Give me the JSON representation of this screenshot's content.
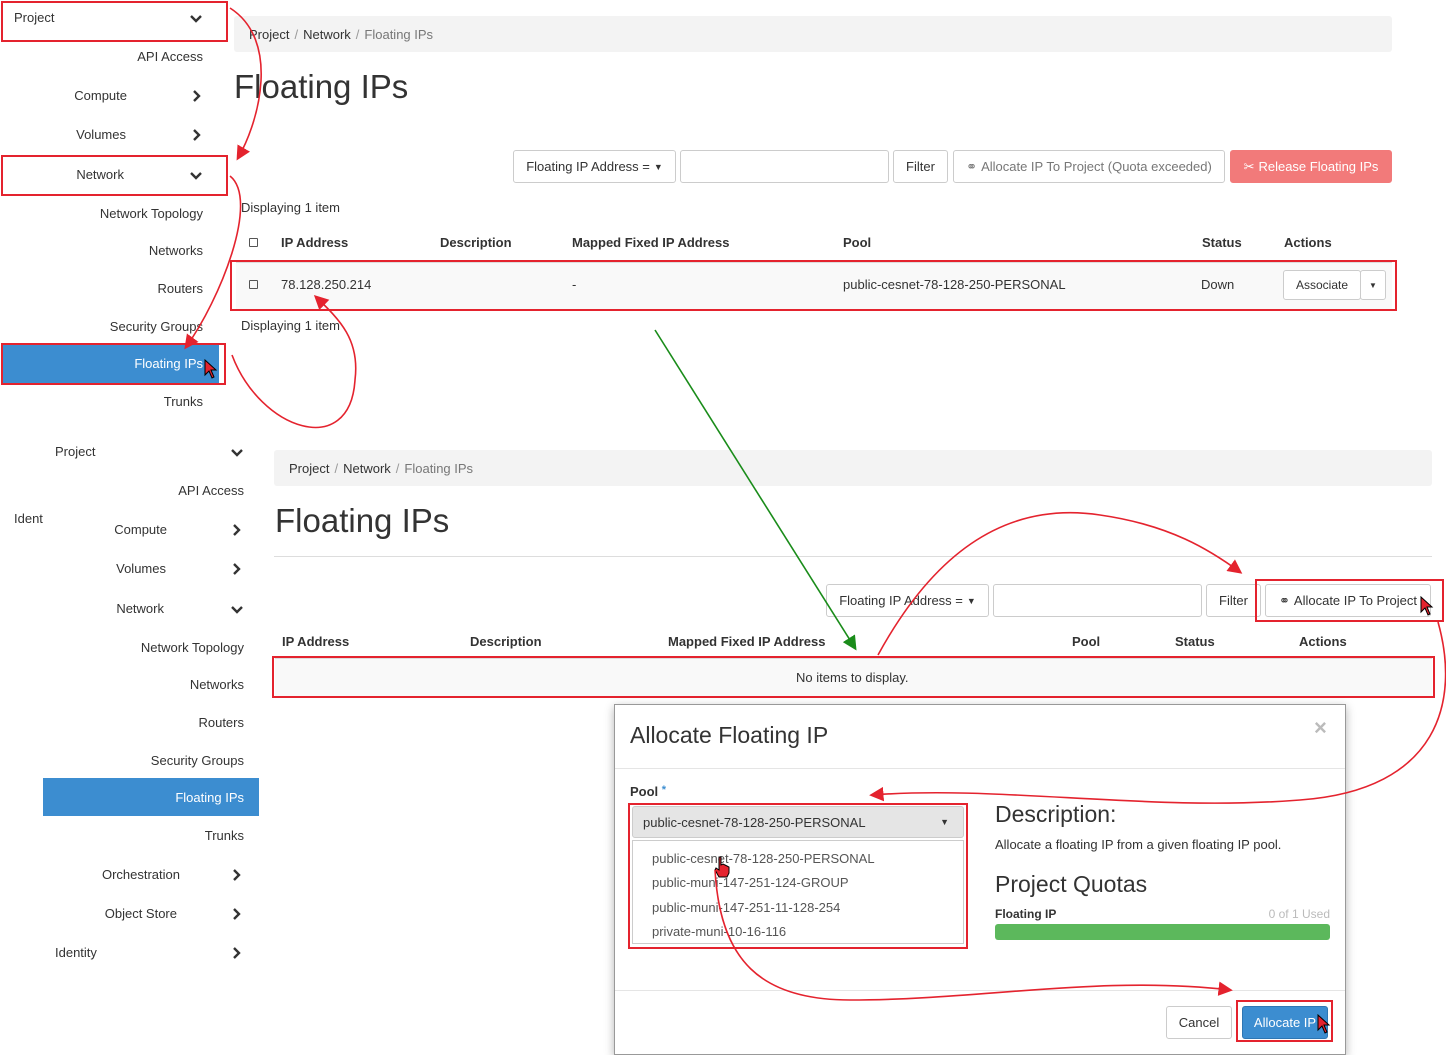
{
  "sidebar_top": {
    "project": "Project",
    "api_access": "API Access",
    "compute": "Compute",
    "volumes": "Volumes",
    "network": "Network",
    "network_topology": "Network Topology",
    "networks": "Networks",
    "routers": "Routers",
    "security_groups": "Security Groups",
    "floating_ips": "Floating IPs",
    "trunks": "Trunks"
  },
  "panel_top": {
    "breadcrumb": [
      "Project",
      "Network",
      "Floating IPs"
    ],
    "title": "Floating IPs",
    "filter_select": "Floating IP Address =",
    "filter_button": "Filter",
    "allocate_button": "Allocate IP To Project (Quota exceeded)",
    "release_button": "Release Floating IPs",
    "displaying": "Displaying 1 item",
    "columns": [
      "IP Address",
      "Description",
      "Mapped Fixed IP Address",
      "Pool",
      "Status",
      "Actions"
    ],
    "row": {
      "ip": "78.128.250.214",
      "description": "",
      "mapped": "-",
      "pool": "public-cesnet-78-128-250-PERSONAL",
      "status": "Down",
      "action": "Associate"
    }
  },
  "sidebar_bottom": {
    "ident": "Ident",
    "project": "Project",
    "api_access": "API Access",
    "compute": "Compute",
    "volumes": "Volumes",
    "network": "Network",
    "network_topology": "Network Topology",
    "networks": "Networks",
    "routers": "Routers",
    "security_groups": "Security Groups",
    "floating_ips": "Floating IPs",
    "trunks": "Trunks",
    "orchestration": "Orchestration",
    "object_store": "Object Store",
    "identity": "Identity"
  },
  "panel_bottom": {
    "breadcrumb": [
      "Project",
      "Network",
      "Floating IPs"
    ],
    "title": "Floating IPs",
    "filter_select": "Floating IP Address =",
    "filter_button": "Filter",
    "allocate_button": "Allocate IP To Project",
    "columns": [
      "IP Address",
      "Description",
      "Mapped Fixed IP Address",
      "Pool",
      "Status",
      "Actions"
    ],
    "empty": "No items to display."
  },
  "modal": {
    "title": "Allocate Floating IP",
    "close": "×",
    "pool_label": "Pool",
    "required_mark": "*",
    "pool_selected": "public-cesnet-78-128-250-PERSONAL",
    "pool_options": [
      "public-cesnet-78-128-250-PERSONAL",
      "public-muni-147-251-124-GROUP",
      "public-muni-147-251-11-128-254",
      "private-muni-10-16-116"
    ],
    "description_heading": "Description:",
    "description_text": "Allocate a floating IP from a given floating IP pool.",
    "quotas_heading": "Project Quotas",
    "quota_label": "Floating IP",
    "quota_value": "0 of 1 Used",
    "quota_fill_fraction": 1.0,
    "cancel": "Cancel",
    "allocate": "Allocate IP"
  },
  "colors": {
    "accent": "#3c8dd0",
    "annotation_red": "#e4232e",
    "annotation_green": "#1a8c1a",
    "danger": "#f27a7a",
    "progress": "#5cb85c"
  }
}
